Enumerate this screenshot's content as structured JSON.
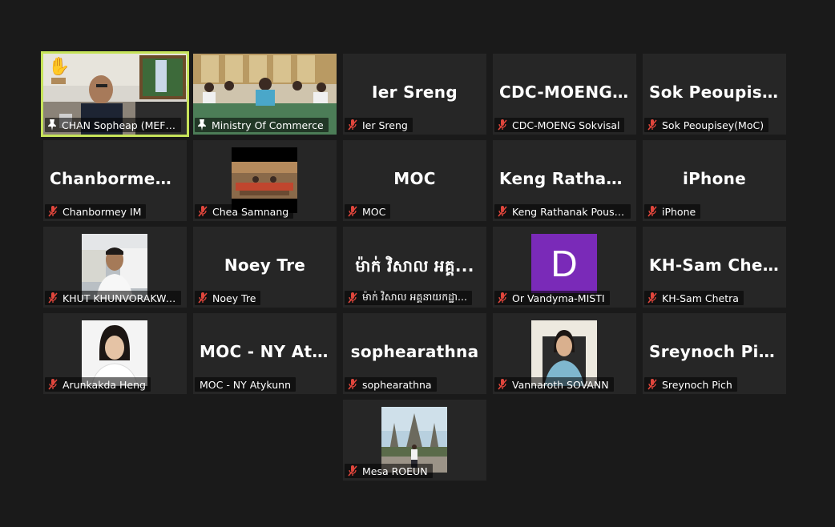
{
  "colors": {
    "background": "#1a1a1a",
    "tile": "#262626",
    "active_speaker_border": "#c6e35a",
    "muted_icon": "#e0463c",
    "avatar_purple": "#7a2ab8"
  },
  "icons": {
    "muted": "microphone-slash-icon",
    "pinned": "pin-icon",
    "raised_hand": "raised-hand-icon"
  },
  "participants": [
    {
      "tile_name": "",
      "label": "CHAN Sopheap (MEF) - ...",
      "muted": false,
      "pinned": true,
      "video": true,
      "raised_hand": true
    },
    {
      "tile_name": "",
      "label": "Ministry Of Commerce",
      "muted": false,
      "pinned": true,
      "video": true
    },
    {
      "tile_name": "Ier Sreng",
      "label": "Ier Sreng",
      "muted": true
    },
    {
      "tile_name": "CDC-MOENG S...",
      "label": "CDC-MOENG Sokvisal",
      "muted": true
    },
    {
      "tile_name": "Sok Peoupisey(...",
      "label": "Sok Peoupisey(MoC)",
      "muted": true
    },
    {
      "tile_name": "Chanbormey IM",
      "label": "Chanbormey IM",
      "muted": true
    },
    {
      "tile_name": "",
      "label": "Chea Samnang",
      "muted": true,
      "picture": true
    },
    {
      "tile_name": "MOC",
      "label": "MOC",
      "muted": true
    },
    {
      "tile_name": "Keng Rathanak...",
      "label": "Keng Rathanak Pousak",
      "muted": true
    },
    {
      "tile_name": "iPhone",
      "label": "iPhone",
      "muted": true
    },
    {
      "tile_name": "",
      "label": "KHUT KHUNVORAKWAD...",
      "muted": true,
      "picture": true
    },
    {
      "tile_name": "Noey Tre",
      "label": "Noey Tre",
      "muted": true
    },
    {
      "tile_name": "ម៉ាក់ វិសាល អគ្គ...",
      "label": "ម៉ាក់ វិសាល អគ្គនាយកដ្ឋា...",
      "muted": true
    },
    {
      "tile_name": "",
      "label": "Or Vandyma-MISTI",
      "muted": true,
      "avatar_letter": "D"
    },
    {
      "tile_name": "KH-Sam Chetra",
      "label": "KH-Sam Chetra",
      "muted": true
    },
    {
      "tile_name": "",
      "label": "Arunkakda Heng",
      "muted": true,
      "picture": true
    },
    {
      "tile_name": "MOC - NY Atyk...",
      "label": "MOC - NY Atykunn",
      "muted": false
    },
    {
      "tile_name": "sophearathna",
      "label": "sophearathna",
      "muted": true
    },
    {
      "tile_name": "",
      "label": "Vannaroth SOVANN",
      "muted": true,
      "picture": true
    },
    {
      "tile_name": "Sreynoch Pich",
      "label": "Sreynoch Pich",
      "muted": true
    },
    {
      "tile_name": "",
      "label": "Mesa ROEUN",
      "muted": true,
      "picture": true
    }
  ]
}
